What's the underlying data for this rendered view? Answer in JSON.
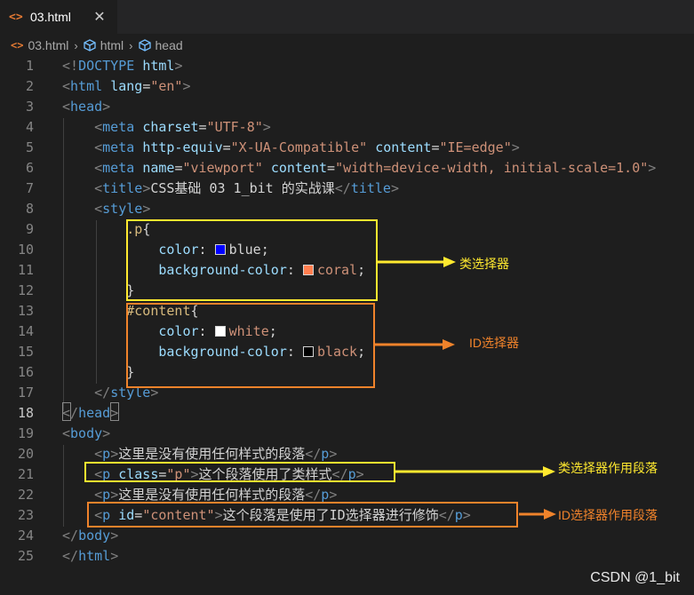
{
  "tab": {
    "label": "03.html",
    "icon": "<>",
    "close": "✕"
  },
  "breadcrumb": [
    "03.html",
    "html",
    "head"
  ],
  "colors": {
    "yellow_box": "#ffe92f",
    "orange_box": "#f0832b",
    "blue_swatch": "#0000ff",
    "coral_swatch": "#ff7f50",
    "white_swatch": "#ffffff",
    "black_swatch": "#000000"
  },
  "lines": [
    {
      "n": "1",
      "indent": 0,
      "tokens": [
        [
          "p",
          "<!"
        ],
        [
          "t",
          "DOCTYPE"
        ],
        [
          "x",
          " "
        ],
        [
          "a",
          "html"
        ],
        [
          "p",
          ">"
        ]
      ]
    },
    {
      "n": "2",
      "indent": 0,
      "tokens": [
        [
          "p",
          "<"
        ],
        [
          "t",
          "html"
        ],
        [
          "x",
          " "
        ],
        [
          "a",
          "lang"
        ],
        [
          "x",
          "="
        ],
        [
          "s",
          "\"en\""
        ],
        [
          "p",
          ">"
        ]
      ]
    },
    {
      "n": "3",
      "indent": 0,
      "tokens": [
        [
          "p",
          "<"
        ],
        [
          "t",
          "head"
        ],
        [
          "p",
          ">"
        ]
      ]
    },
    {
      "n": "4",
      "indent": 1,
      "tokens": [
        [
          "p",
          "<"
        ],
        [
          "t",
          "meta"
        ],
        [
          "x",
          " "
        ],
        [
          "a",
          "charset"
        ],
        [
          "x",
          "="
        ],
        [
          "s",
          "\"UTF-8\""
        ],
        [
          "p",
          ">"
        ]
      ]
    },
    {
      "n": "5",
      "indent": 1,
      "tokens": [
        [
          "p",
          "<"
        ],
        [
          "t",
          "meta"
        ],
        [
          "x",
          " "
        ],
        [
          "a",
          "http-equiv"
        ],
        [
          "x",
          "="
        ],
        [
          "s",
          "\"X-UA-Compatible\""
        ],
        [
          "x",
          " "
        ],
        [
          "a",
          "content"
        ],
        [
          "x",
          "="
        ],
        [
          "s",
          "\"IE=edge\""
        ],
        [
          "p",
          ">"
        ]
      ]
    },
    {
      "n": "6",
      "indent": 1,
      "tokens": [
        [
          "p",
          "<"
        ],
        [
          "t",
          "meta"
        ],
        [
          "x",
          " "
        ],
        [
          "a",
          "name"
        ],
        [
          "x",
          "="
        ],
        [
          "s",
          "\"viewport\""
        ],
        [
          "x",
          " "
        ],
        [
          "a",
          "content"
        ],
        [
          "x",
          "="
        ],
        [
          "s",
          "\"width=device-width, initial-scale=1.0\""
        ],
        [
          "p",
          ">"
        ]
      ]
    },
    {
      "n": "7",
      "indent": 1,
      "tokens": [
        [
          "p",
          "<"
        ],
        [
          "t",
          "title"
        ],
        [
          "p",
          ">"
        ],
        [
          "x",
          "CSS基础 03 1_bit 的实战课"
        ],
        [
          "p",
          "</"
        ],
        [
          "t",
          "title"
        ],
        [
          "p",
          ">"
        ]
      ]
    },
    {
      "n": "8",
      "indent": 1,
      "tokens": [
        [
          "p",
          "<"
        ],
        [
          "t",
          "style"
        ],
        [
          "p",
          ">"
        ]
      ]
    },
    {
      "n": "9",
      "indent": 2,
      "tokens": [
        [
          "e",
          ".p"
        ],
        [
          "x",
          "{"
        ]
      ]
    },
    {
      "n": "10",
      "indent": 3,
      "tokens": [
        [
          "r",
          "color"
        ],
        [
          "x",
          ": "
        ],
        [
          "w",
          "blue"
        ],
        [
          "x",
          "blue;"
        ]
      ]
    },
    {
      "n": "11",
      "indent": 3,
      "tokens": [
        [
          "r",
          "background-color"
        ],
        [
          "x",
          ": "
        ],
        [
          "w",
          "coral"
        ],
        [
          "s",
          "coral"
        ],
        [
          "x",
          ";"
        ]
      ]
    },
    {
      "n": "12",
      "indent": 2,
      "tokens": [
        [
          "x",
          "}"
        ]
      ]
    },
    {
      "n": "13",
      "indent": 2,
      "tokens": [
        [
          "e",
          "#content"
        ],
        [
          "x",
          "{"
        ]
      ]
    },
    {
      "n": "14",
      "indent": 3,
      "tokens": [
        [
          "r",
          "color"
        ],
        [
          "x",
          ": "
        ],
        [
          "w",
          "white"
        ],
        [
          "s",
          "white"
        ],
        [
          "x",
          ";"
        ]
      ]
    },
    {
      "n": "15",
      "indent": 3,
      "tokens": [
        [
          "r",
          "background-color"
        ],
        [
          "x",
          ": "
        ],
        [
          "w",
          "black"
        ],
        [
          "s",
          "black"
        ],
        [
          "x",
          ";"
        ]
      ]
    },
    {
      "n": "16",
      "indent": 2,
      "tokens": [
        [
          "x",
          "}"
        ]
      ]
    },
    {
      "n": "17",
      "indent": 1,
      "tokens": [
        [
          "p",
          "</"
        ],
        [
          "t",
          "style"
        ],
        [
          "p",
          ">"
        ]
      ]
    },
    {
      "n": "18",
      "indent": 0,
      "tokens": [
        [
          "p",
          "</"
        ],
        [
          "t",
          "head"
        ],
        [
          "p",
          ">"
        ]
      ]
    },
    {
      "n": "19",
      "indent": 0,
      "tokens": [
        [
          "p",
          "<"
        ],
        [
          "t",
          "body"
        ],
        [
          "p",
          ">"
        ]
      ]
    },
    {
      "n": "20",
      "indent": 1,
      "tokens": [
        [
          "p",
          "<"
        ],
        [
          "t",
          "p"
        ],
        [
          "p",
          ">"
        ],
        [
          "x",
          "这里是没有使用任何样式的段落"
        ],
        [
          "p",
          "</"
        ],
        [
          "t",
          "p"
        ],
        [
          "p",
          ">"
        ]
      ]
    },
    {
      "n": "21",
      "indent": 1,
      "tokens": [
        [
          "p",
          "<"
        ],
        [
          "t",
          "p"
        ],
        [
          "x",
          " "
        ],
        [
          "a",
          "class"
        ],
        [
          "x",
          "="
        ],
        [
          "s",
          "\"p\""
        ],
        [
          "p",
          ">"
        ],
        [
          "x",
          "这个段落使用了类样式"
        ],
        [
          "p",
          "</"
        ],
        [
          "t",
          "p"
        ],
        [
          "p",
          ">"
        ]
      ]
    },
    {
      "n": "22",
      "indent": 1,
      "tokens": [
        [
          "p",
          "<"
        ],
        [
          "t",
          "p"
        ],
        [
          "p",
          ">"
        ],
        [
          "x",
          "这里是没有使用任何样式的段落"
        ],
        [
          "p",
          "</"
        ],
        [
          "t",
          "p"
        ],
        [
          "p",
          ">"
        ]
      ]
    },
    {
      "n": "23",
      "indent": 1,
      "tokens": [
        [
          "p",
          "<"
        ],
        [
          "t",
          "p"
        ],
        [
          "x",
          " "
        ],
        [
          "a",
          "id"
        ],
        [
          "x",
          "="
        ],
        [
          "s",
          "\"content\""
        ],
        [
          "p",
          ">"
        ],
        [
          "x",
          "这个段落是使用了ID选择器进行修饰"
        ],
        [
          "p",
          "</"
        ],
        [
          "t",
          "p"
        ],
        [
          "p",
          ">"
        ]
      ]
    },
    {
      "n": "24",
      "indent": 0,
      "tokens": [
        [
          "p",
          "</"
        ],
        [
          "t",
          "body"
        ],
        [
          "p",
          ">"
        ]
      ]
    },
    {
      "n": "25",
      "indent": 0,
      "tokens": [
        [
          "p",
          "</"
        ],
        [
          "t",
          "html"
        ],
        [
          "p",
          ">"
        ]
      ]
    }
  ],
  "active_line": "18",
  "annotations": {
    "class_selector": "类选择器",
    "id_selector": "ID选择器",
    "class_paragraph": "类选择器作用段落",
    "id_paragraph": "ID选择器作用段落"
  },
  "watermark": "CSDN @1_bit"
}
